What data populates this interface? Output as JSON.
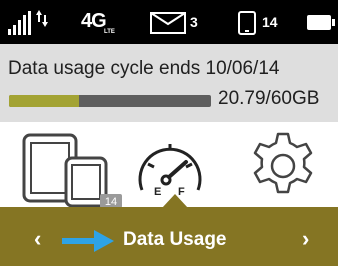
{
  "status_bar": {
    "signal_icon": "signal-strength-icon",
    "transfer_icon": "data-transfer-icon",
    "network_label": "4G",
    "network_sublabel": "LTE",
    "mail_icon": "envelope-icon",
    "mail_count": "3",
    "device_icon": "connected-devices-icon",
    "device_count": "14",
    "battery_icon": "battery-icon"
  },
  "usage": {
    "cycle_text": "Data usage cycle ends 10/06/14",
    "used_amount": "20.79/60GB",
    "fraction_used": 0.3465,
    "bar_fill_color": "#a3a333",
    "bar_track_color": "#5e5e5e"
  },
  "icons": {
    "devices": {
      "icon": "connected-devices-icon",
      "badge": "14"
    },
    "gauge": {
      "icon": "fuel-gauge-icon",
      "label_empty": "E",
      "label_full": "F"
    },
    "settings": {
      "icon": "gear-icon"
    }
  },
  "nav": {
    "prev_glyph": "‹",
    "title": "Data Usage",
    "next_glyph": "›",
    "arrow_color": "#2ea3e6",
    "bar_color": "#857523"
  }
}
